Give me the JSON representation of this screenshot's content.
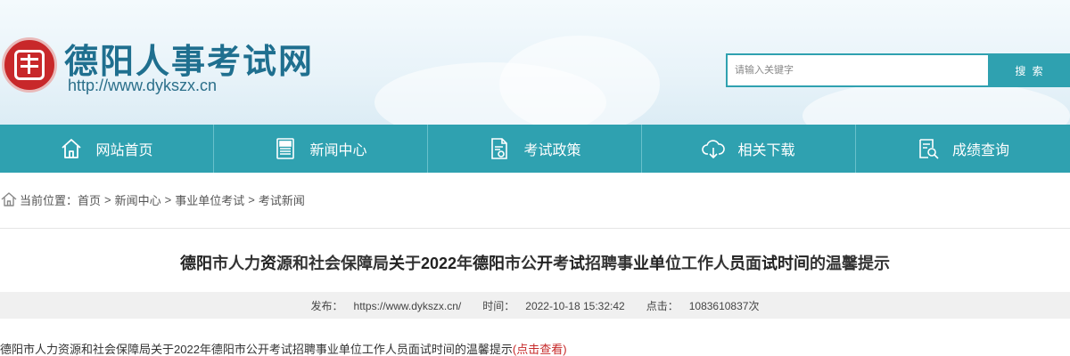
{
  "header": {
    "site_title": "德阳人事考试网",
    "site_url": "http://www.dykszx.cn",
    "logo_icon": "seal-logo-icon"
  },
  "search": {
    "placeholder": "请输入关键字",
    "button_label": "搜 索"
  },
  "nav": {
    "items": [
      {
        "label": "网站首页",
        "icon": "home-icon"
      },
      {
        "label": "新闻中心",
        "icon": "news-icon"
      },
      {
        "label": "考试政策",
        "icon": "policy-document-icon"
      },
      {
        "label": "相关下载",
        "icon": "cloud-download-icon"
      },
      {
        "label": "成绩查询",
        "icon": "score-search-icon"
      }
    ]
  },
  "breadcrumb": {
    "prefix": "当前位置：",
    "items": [
      "首页",
      "新闻中心",
      "事业单位考试",
      "考试新闻"
    ],
    "separator": ">"
  },
  "article": {
    "title_parts": [
      {
        "text": "德阳",
        "bold": true
      },
      {
        "text": "市人力",
        "bold": false
      },
      {
        "text": "资",
        "bold": true
      },
      {
        "text": "源和社会保障局",
        "bold": false
      },
      {
        "text": "关",
        "bold": true
      },
      {
        "text": "于",
        "bold": false
      },
      {
        "text": "2022",
        "bold": true
      },
      {
        "text": "年",
        "bold": false
      },
      {
        "text": "德阳",
        "bold": true
      },
      {
        "text": "市公",
        "bold": false
      },
      {
        "text": "开",
        "bold": true
      },
      {
        "text": "考",
        "bold": false
      },
      {
        "text": "试",
        "bold": true
      },
      {
        "text": "招聘事",
        "bold": false
      },
      {
        "text": "业单",
        "bold": true
      },
      {
        "text": "位工作人",
        "bold": false
      },
      {
        "text": "员",
        "bold": true
      },
      {
        "text": "面",
        "bold": false
      },
      {
        "text": "试时间",
        "bold": true
      },
      {
        "text": "的温馨提示",
        "bold": false
      }
    ],
    "meta": {
      "source_label": "发布：",
      "source": "https://www.dykszx.cn/",
      "time_label": "时间：",
      "time": "2022-10-18 15:32:42",
      "clicks_label": "点击：",
      "clicks": "1083610837次"
    },
    "body_text": "德阳市人力资源和社会保障局关于2022年德阳市公开考试招聘事业单位工作人员面试时间的温馨提示",
    "body_link": "(点击查看)"
  },
  "colors": {
    "accent": "#2fa1b0",
    "title": "#1f6f8f",
    "link_red": "#c62828",
    "seal_red": "#c8282a"
  }
}
